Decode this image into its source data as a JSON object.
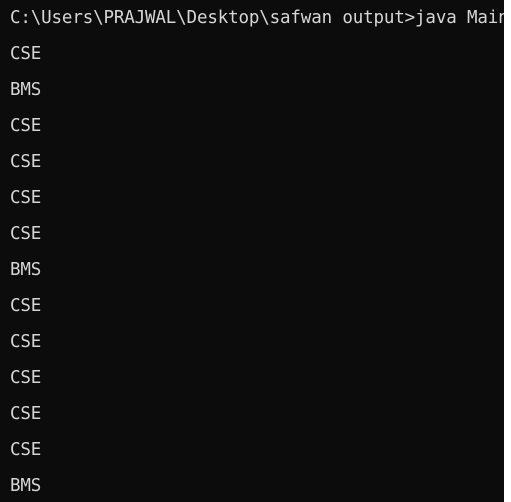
{
  "terminal": {
    "prompt_line": "C:\\Users\\PRAJWAL\\Desktop\\safwan output>java Main",
    "output_lines": [
      "CSE",
      "BMS",
      "CSE",
      "CSE",
      "CSE",
      "CSE",
      "BMS",
      "CSE",
      "CSE",
      "CSE",
      "CSE",
      "CSE",
      "BMS"
    ],
    "colors": {
      "background": "#0c0c0c",
      "text": "#d6d6d6",
      "right_margin": "#ffffff"
    }
  }
}
